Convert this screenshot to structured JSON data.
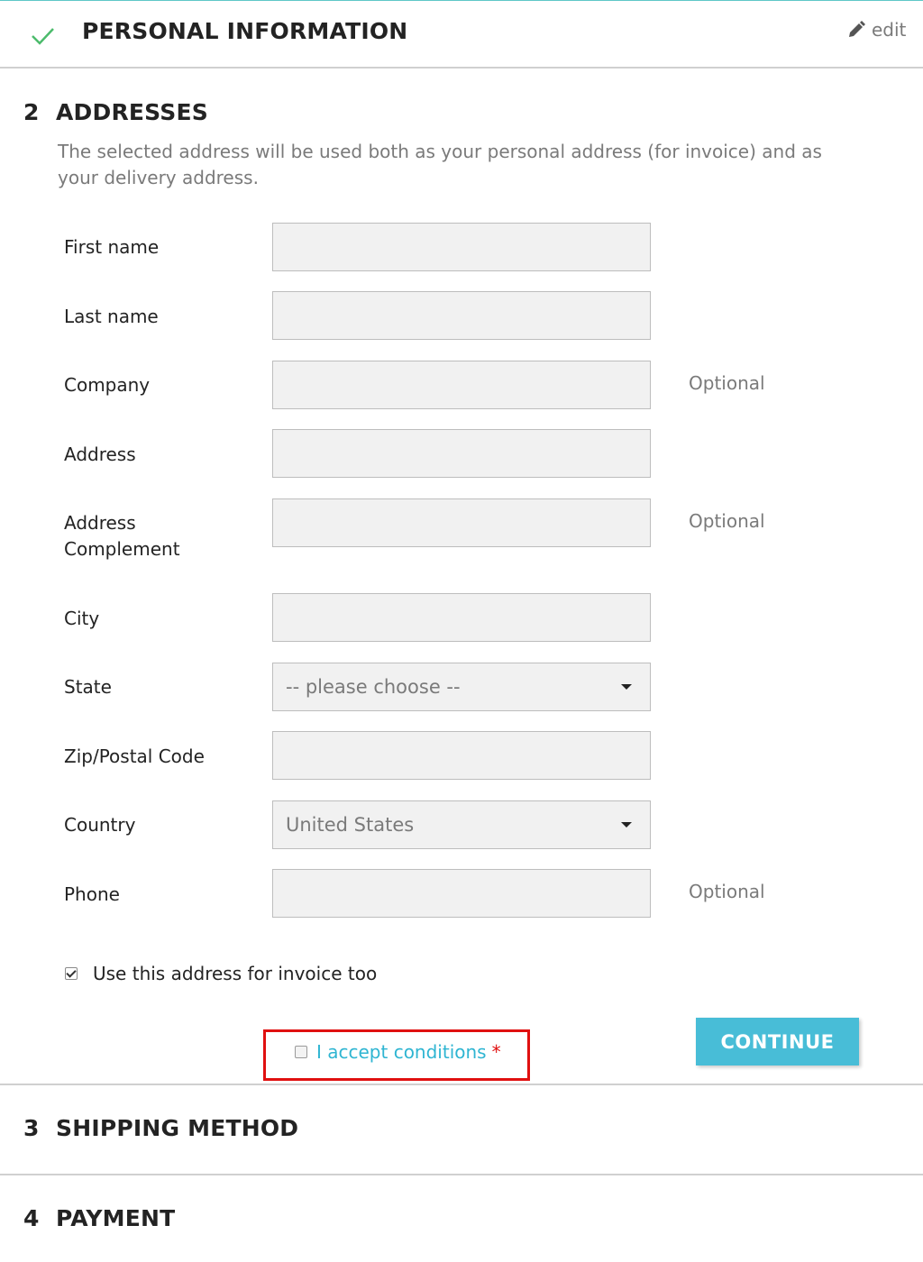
{
  "step1": {
    "title": "PERSONAL INFORMATION",
    "status_icon": "check-icon",
    "edit_icon": "pencil-icon",
    "edit_label": "edit"
  },
  "step2": {
    "number": "2",
    "title": "ADDRESSES",
    "intro": "The selected address will be used both as your personal address (for invoice) and as your delivery address.",
    "fields": {
      "first_name": {
        "label": "First name",
        "value": ""
      },
      "last_name": {
        "label": "Last name",
        "value": ""
      },
      "company": {
        "label": "Company",
        "value": "",
        "hint": "Optional"
      },
      "address": {
        "label": "Address",
        "value": ""
      },
      "address_complement": {
        "label": "Address Complement",
        "value": "",
        "hint": "Optional"
      },
      "city": {
        "label": "City",
        "value": ""
      },
      "state": {
        "label": "State",
        "selected": "-- please choose --"
      },
      "zip": {
        "label": "Zip/Postal Code",
        "value": ""
      },
      "country": {
        "label": "Country",
        "selected": "United States"
      },
      "phone": {
        "label": "Phone",
        "value": "",
        "hint": "Optional"
      }
    },
    "invoice_checkbox": {
      "label": "Use this address for invoice too",
      "checked": true
    },
    "accept_conditions": {
      "label": "I accept conditions",
      "required_mark": "*",
      "checked": false
    },
    "continue_label": "CONTINUE"
  },
  "step3": {
    "number": "3",
    "title": "SHIPPING METHOD"
  },
  "step4": {
    "number": "4",
    "title": "PAYMENT"
  },
  "colors": {
    "accent": "#2fb5d2",
    "check": "#4cbb6c",
    "highlight_border": "#e01010",
    "muted_text": "#7a7a7a"
  }
}
